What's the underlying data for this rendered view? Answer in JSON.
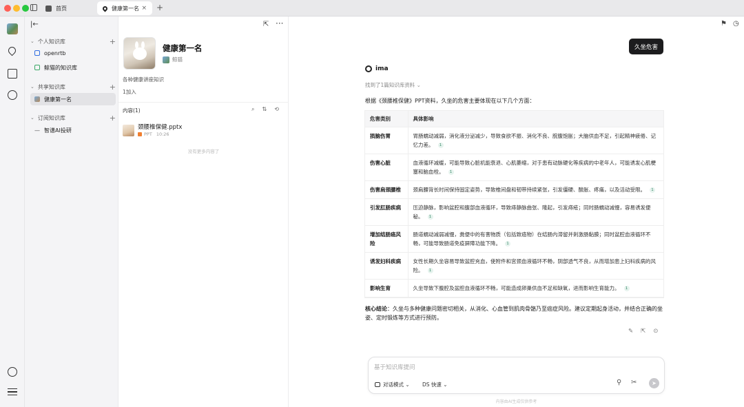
{
  "tabs": {
    "home_label": "首页",
    "active_label": "健康第一名",
    "close_glyph": "×",
    "add_glyph": "+"
  },
  "sidebar": {
    "collapse_glyph": "|←",
    "sections": {
      "personal": "个人知识库",
      "shared": "共享知识库",
      "subscribed": "订阅知识库"
    },
    "items": {
      "openrtb": "openrtb",
      "fish_cat": "鲸猫的知识库",
      "health": "健康第一名",
      "ai_research": "智谱AI投研"
    }
  },
  "kb_detail": {
    "title": "健康第一名",
    "author": "鲸猫",
    "description": "各种健康讲座知识",
    "joined": "1加入",
    "content_header": "内容(1)",
    "file": {
      "name": "颈腰椎保健.pptx",
      "type": "PPT",
      "time": "10:26"
    },
    "no_more": "没有更多内容了"
  },
  "chat": {
    "user_message": "久坐危害",
    "assistant_name": "ima",
    "found_text": "找到了1篇知识库资料",
    "intro": "根据《颈腰椎保健》PPT资料，久坐的危害主要体现在以下几个方面：",
    "table": {
      "headers": [
        "危害类别",
        "具体影响"
      ],
      "rows": [
        {
          "category": "损脑伤胃",
          "impact": "胃肠蠕动减弱，消化液分泌减少，导致食欲不振、消化不良、脘腹饱胀；大脑供血不足，引起精神疲倦、记忆力差。",
          "cite": "1"
        },
        {
          "category": "伤害心脏",
          "impact": "血液循环减缓，可能导致心脏机能衰退、心肌萎缩，对于患有动脉硬化等疾病的中老年人，可能诱发心肌梗塞和脑血栓。",
          "cite": "1"
        },
        {
          "category": "伤害肩颈腰椎",
          "impact": "颈肩腰背长时间保持固定姿势，导致椎间盘和韧带持续紧张，引发僵硬、酸胀、疼痛，以及活动受限。",
          "cite": "1"
        },
        {
          "category": "引发肛肠疾病",
          "impact": "压迫静脉，影响盆腔和腹部血液循环，导致痔静脉曲张、隆起，引发痔疮；同时肠蠕动减慢，容易诱发便秘。",
          "cite": "1"
        },
        {
          "category": "增加结肠癌风险",
          "impact": "肠道蠕动减弱减慢，粪便中的有害物质（包括致癌物）在结肠内滞留并刺激肠黏膜；同时盆腔血液循环不畅，可能导致肠道免疫屏障功能下降。",
          "cite": "1"
        },
        {
          "category": "诱发妇科疾病",
          "impact": "女性长期久坐容易导致盆腔充血，使附件和宫颈血液循环不畅，阴部透气不良，从而增加患上妇科疾病的风险。",
          "cite": "1"
        },
        {
          "category": "影响生育",
          "impact": "久坐导致下腹腔及盆腔血液循环不畅，可能造成卵巢供血不足和缺氧，进而影响生育能力。",
          "cite": "1"
        }
      ]
    },
    "conclusion_label": "核心结论",
    "conclusion_text": "：久坐与多种健康问题密切相关，从消化、心血管到肌肉骨骼乃至癌症风险。建议定期起身活动，并结合正确的坐姿、定时锻炼等方式进行预防。",
    "input_placeholder": "基于知识库提问",
    "mode_label": "对话模式",
    "model_label": "DS 快速",
    "disclaimer": "内容由AI生成仅供参考"
  },
  "icons": {
    "sidebar_toggle": "sidebar-icon",
    "home": "home-icon",
    "location": "location-icon",
    "write": "edit-icon",
    "explore": "compass-icon",
    "history": "clock-icon",
    "menu": "menu-icon",
    "search": "search-icon",
    "sort": "sort-icon",
    "refresh": "refresh-icon",
    "share": "share-icon",
    "more": "more-icon",
    "attach": "paperclip-icon",
    "send": "send-icon"
  },
  "colors": {
    "user_bubble": "#1c1c1e",
    "cite_badge": "#e6f3ee",
    "ppt_badge": "#f07f30",
    "traffic_close": "#fe5f57",
    "traffic_min": "#febc2e",
    "traffic_max": "#28c840"
  }
}
